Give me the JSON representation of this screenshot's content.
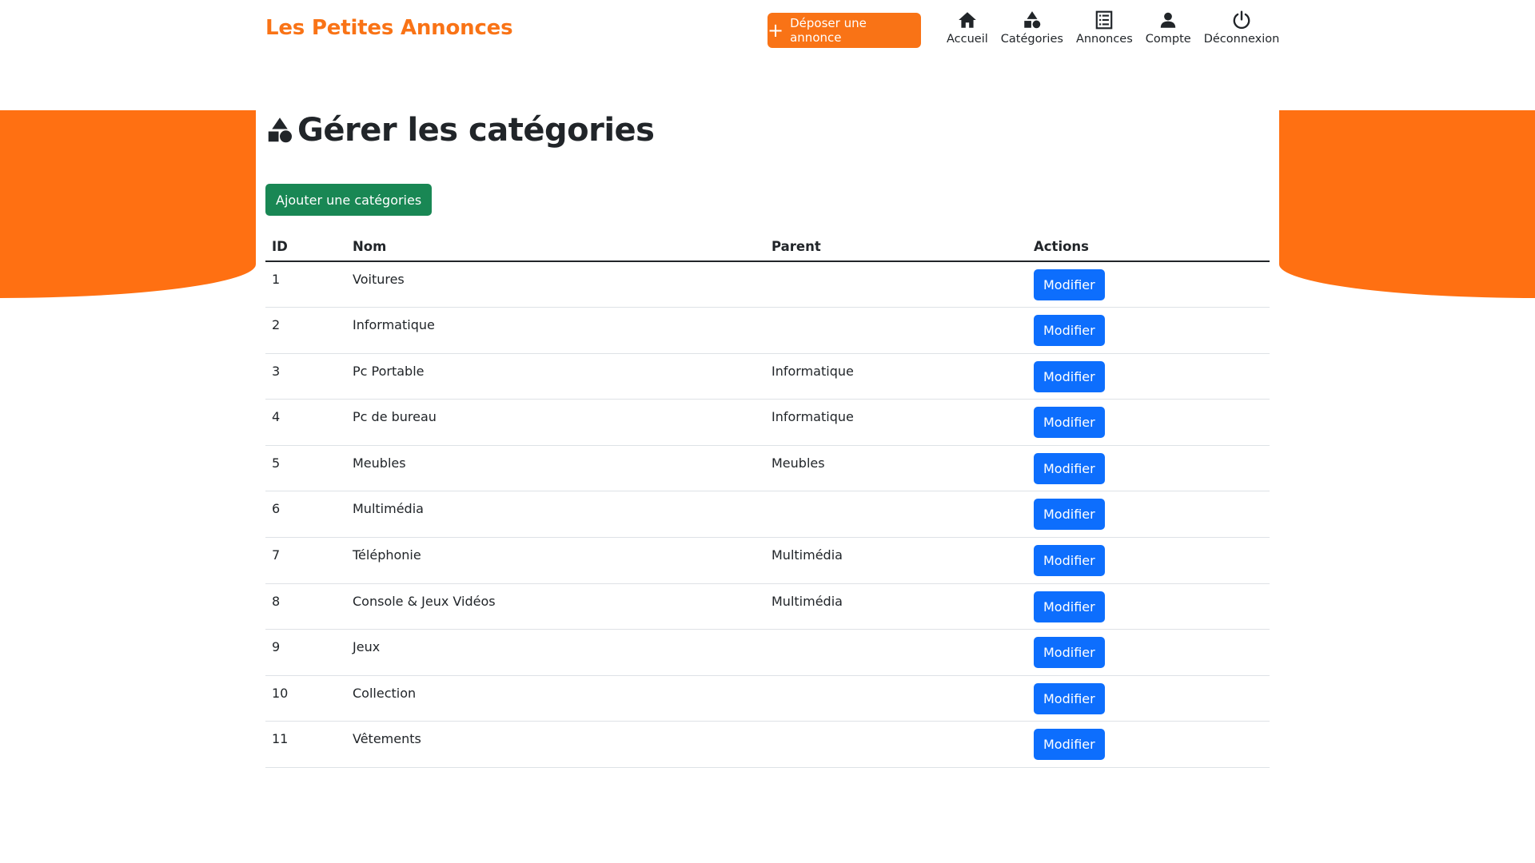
{
  "header": {
    "brand": "Les Petites Annonces",
    "post_button": "Déposer une annonce",
    "nav": [
      {
        "label": "Accueil",
        "icon": "home-icon"
      },
      {
        "label": "Catégories",
        "icon": "shapes-icon"
      },
      {
        "label": "Annonces",
        "icon": "list-icon"
      },
      {
        "label": "Compte",
        "icon": "user-icon"
      },
      {
        "label": "Déconnexion",
        "icon": "power-icon"
      }
    ]
  },
  "main": {
    "title": "Gérer les catégories",
    "add_button": "Ajouter une catégories",
    "table": {
      "headers": [
        "ID",
        "Nom",
        "Parent",
        "Actions"
      ],
      "rows": [
        {
          "id": "1",
          "nom": "Voitures",
          "parent": "",
          "action": "Modifier"
        },
        {
          "id": "2",
          "nom": "Informatique",
          "parent": "",
          "action": "Modifier"
        },
        {
          "id": "3",
          "nom": "Pc Portable",
          "parent": "Informatique",
          "action": "Modifier"
        },
        {
          "id": "4",
          "nom": "Pc de bureau",
          "parent": "Informatique",
          "action": "Modifier"
        },
        {
          "id": "5",
          "nom": "Meubles",
          "parent": "Meubles",
          "action": "Modifier"
        },
        {
          "id": "6",
          "nom": "Multimédia",
          "parent": "",
          "action": "Modifier"
        },
        {
          "id": "7",
          "nom": "Téléphonie",
          "parent": "Multimédia",
          "action": "Modifier"
        },
        {
          "id": "8",
          "nom": "Console & Jeux Vidéos",
          "parent": "Multimédia",
          "action": "Modifier"
        },
        {
          "id": "9",
          "nom": "Jeux",
          "parent": "",
          "action": "Modifier"
        },
        {
          "id": "10",
          "nom": "Collection",
          "parent": "",
          "action": "Modifier"
        },
        {
          "id": "11",
          "nom": "Vêtements",
          "parent": "",
          "action": "Modifier"
        }
      ]
    }
  },
  "colors": {
    "brand_orange": "#f97316",
    "wave_orange": "#ff7012",
    "success_green": "#198754",
    "primary_blue": "#0d6efd"
  }
}
